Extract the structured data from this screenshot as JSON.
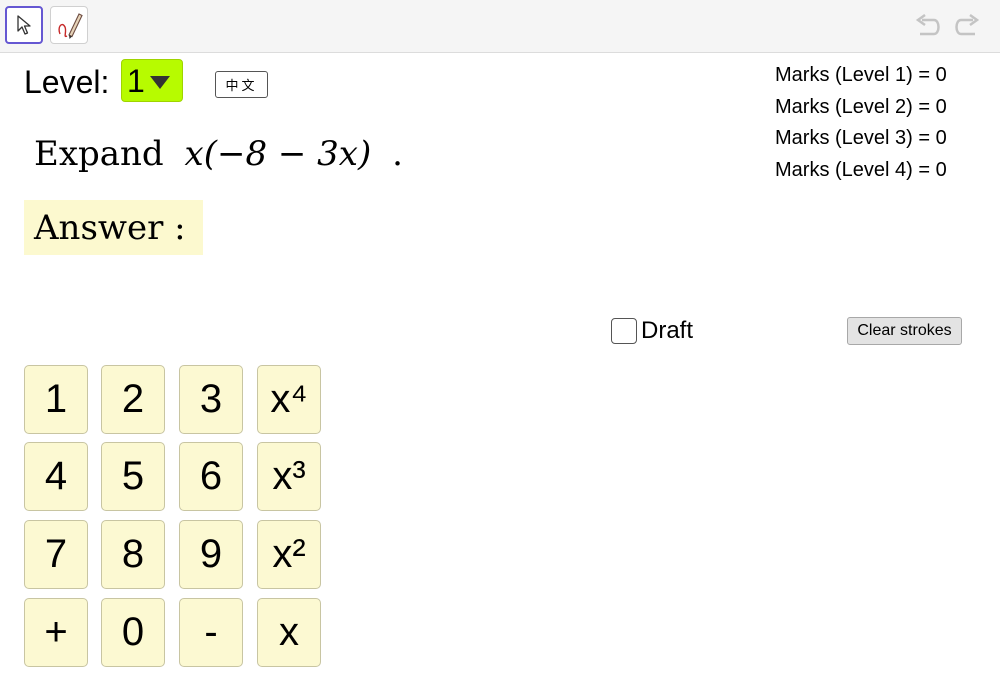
{
  "toolbar": {
    "tools": [
      {
        "icon": "cursor-icon",
        "active": true
      },
      {
        "icon": "pen-icon",
        "active": false
      }
    ],
    "undo_icon": "undo-icon",
    "redo_icon": "redo-icon"
  },
  "level": {
    "label": "Level:",
    "selected": "1",
    "accent": "#b7fb00"
  },
  "language_button": "中文",
  "marks": [
    "Marks (Level 1) = 0",
    "Marks (Level 2) = 0",
    "Marks (Level 3) = 0",
    "Marks (Level 4) = 0"
  ],
  "question": {
    "verb": "Expand",
    "expression": "x(−8 − 3x)",
    "trailing": "."
  },
  "answer": {
    "label": "Answer :",
    "background": "#fcf9cf"
  },
  "draft": {
    "label": "Draft",
    "checked": false
  },
  "clear_strokes_label": "Clear strokes",
  "keypad": {
    "background": "#fcf9d2",
    "rows": [
      [
        "1",
        "2",
        "3",
        "x⁴"
      ],
      [
        "4",
        "5",
        "6",
        "x³"
      ],
      [
        "7",
        "8",
        "9",
        "x²"
      ],
      [
        "+",
        "0",
        "-",
        "x"
      ]
    ]
  }
}
